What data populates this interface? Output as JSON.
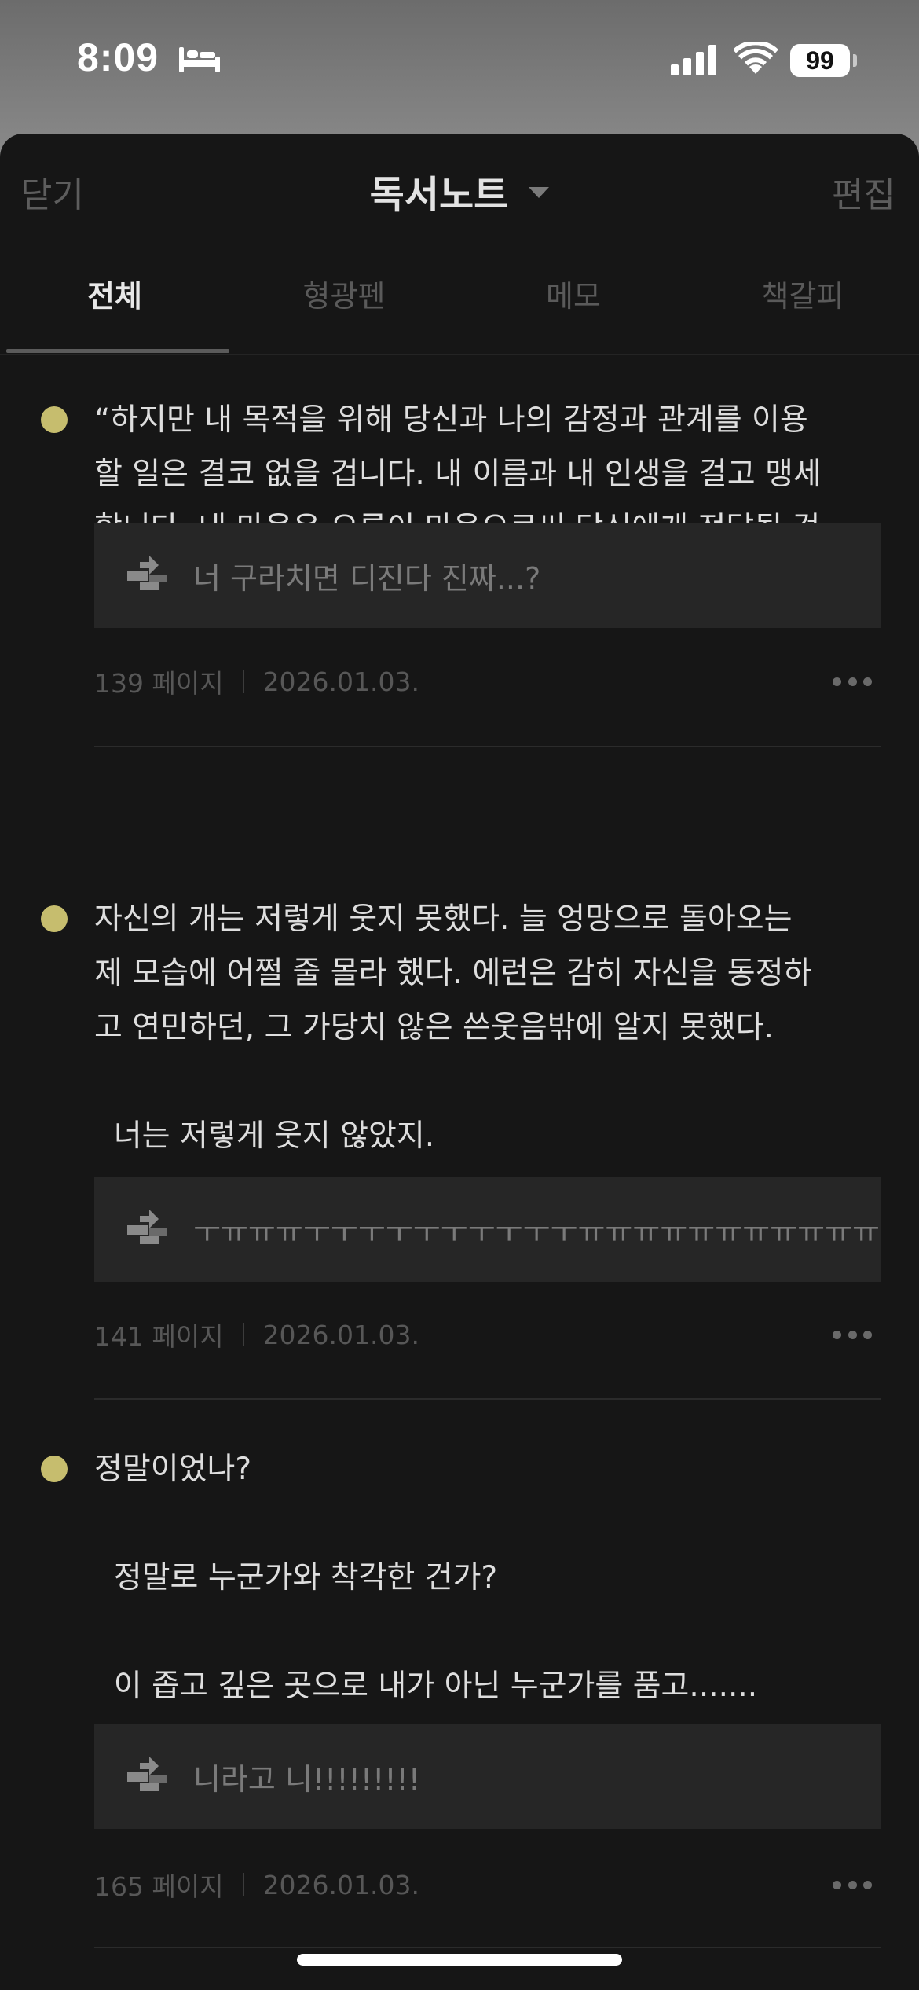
{
  "status_bar": {
    "time": "8:09",
    "battery": "99"
  },
  "nav": {
    "close_label": "닫기",
    "title": "독서노트",
    "edit_label": "편집"
  },
  "tabs": [
    {
      "label": "전체",
      "active": true
    },
    {
      "label": "형광펜",
      "active": false
    },
    {
      "label": "메모",
      "active": false
    },
    {
      "label": "책갈피",
      "active": false
    }
  ],
  "notes": [
    {
      "highlight_color": "#c6bd6e",
      "text": "“하지만 내 목적을 위해 당신과 나의 감정과 관계를 이용\n할 일은 결코 없을 겁니다. 내 이름과 내 인생을 걸고 맹세\n합니다. 내 마음은 오롯이 마음으로써 당신에게 전달될 겁\n니다.”",
      "memo": "너 구라치면 디진다 진짜...?",
      "page": "139 페이지",
      "date": "2026.01.03."
    },
    {
      "highlight_color": "#c6bd6e",
      "text": "자신의 개는 저렇게 웃지 못했다. 늘 엉망으로 돌아오는\n제 모습에 어쩔 줄 몰라 했다. 에런은 감히 자신을 동정하\n고 연민하던, 그 가당치 않은 쓴웃음밖에 알지 못했다.\n\n  너는 저렇게 웃지 않았지.",
      "memo": "ㅜㅠㅠㅠㅜㅜㅜㅜㅜㅜㅜㅜㅜㅜㅠㅠㅠㅠㅠㅠㅠㅠㅠㅠㅠ",
      "page": "141 페이지",
      "date": "2026.01.03."
    },
    {
      "highlight_color": "#c6bd6e",
      "text": "정말이었나?\n\n  정말로 누군가와 착각한 건가?\n\n  이 좁고 깊은 곳으로 내가 아닌 누군가를 품고.......",
      "memo": "니라고 니!!!!!!!!!",
      "page": "165 페이지",
      "date": "2026.01.03."
    }
  ],
  "icons": {
    "memo": "memo-direction-icon",
    "more": "more-dots-icon"
  }
}
